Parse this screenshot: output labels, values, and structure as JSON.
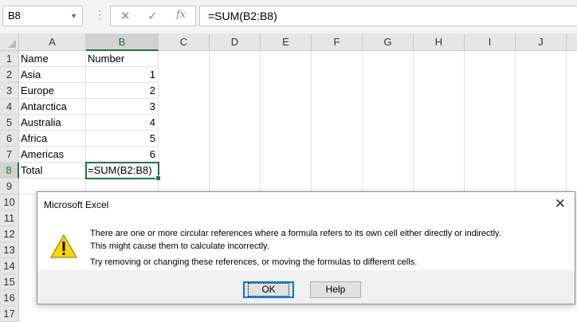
{
  "formula_bar": {
    "name_box": "B8",
    "cancel_icon": "✕",
    "enter_icon": "✓",
    "fx_label": "fx",
    "formula": "=SUM(B2:B8)"
  },
  "columns": [
    "A",
    "B",
    "C",
    "D",
    "E",
    "F",
    "G",
    "H",
    "I",
    "J"
  ],
  "selected_column": "B",
  "row_numbers": [
    "1",
    "2",
    "3",
    "4",
    "5",
    "6",
    "7",
    "8",
    "9",
    "10",
    "11",
    "12",
    "13",
    "14",
    "15",
    "16",
    "17"
  ],
  "selected_row": "8",
  "cells": {
    "A1": "Name",
    "B1": "Number",
    "A2": "Asia",
    "B2": "1",
    "A3": "Europe",
    "B3": "2",
    "A4": "Antarctica",
    "B4": "3",
    "A5": "Australia",
    "B5": "4",
    "A6": "Africa",
    "B6": "5",
    "A7": "Americas",
    "B7": "6",
    "A8": "Total",
    "B8": "=SUM(B2:B8)"
  },
  "dialog": {
    "title": "Microsoft Excel",
    "close_icon": "✕",
    "icon": "warning-icon",
    "message_line1": "There are one or more circular references where a formula refers to its own cell either directly or indirectly.",
    "message_line2": "This might cause them to calculate incorrectly.",
    "message_line3": "Try removing or changing these references, or moving the formulas to different cells.",
    "ok_label": "OK",
    "help_label": "Help"
  },
  "colors": {
    "accent": "#217346",
    "header_bg": "#e6e6e6",
    "dialog_focus": "#0078d7",
    "warning": "#ffd800"
  }
}
